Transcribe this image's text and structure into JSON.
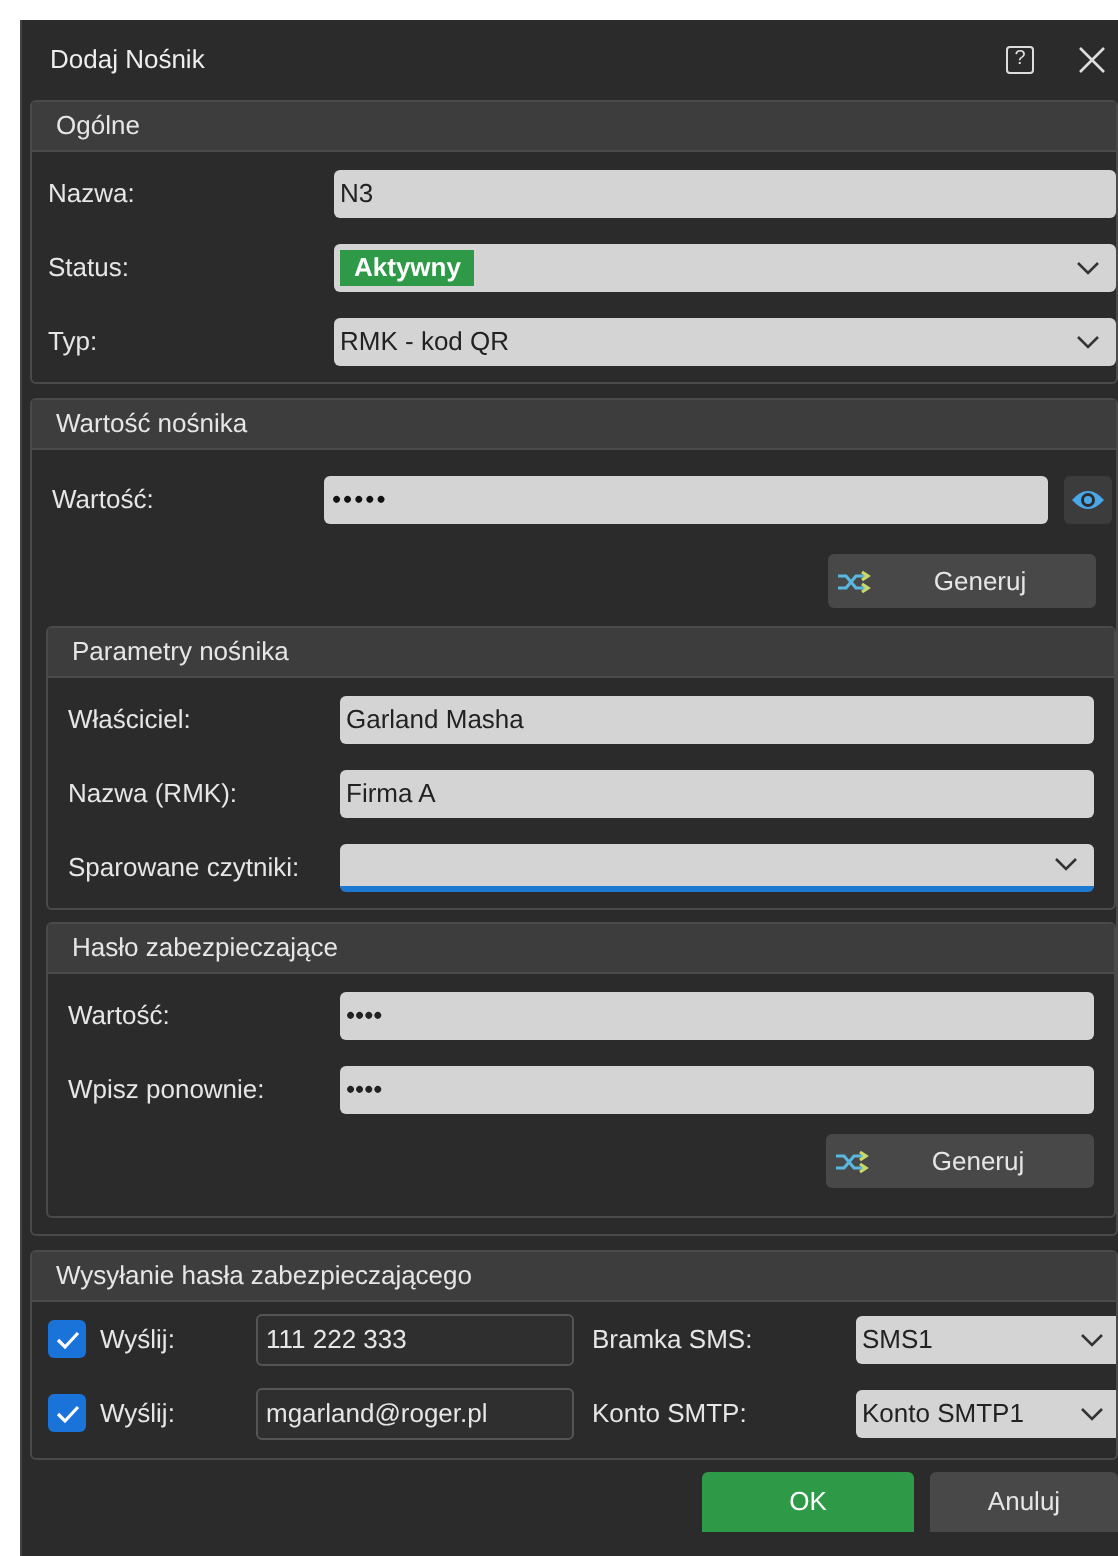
{
  "window": {
    "title": "Dodaj Nośnik",
    "help_icon_text": "?"
  },
  "general": {
    "title": "Ogólne",
    "fields": [
      {
        "kind": "text",
        "label": "Nazwa:",
        "value": "N3"
      },
      {
        "kind": "status",
        "label": "Status:",
        "value": "Aktywny",
        "color": "#2e9a48"
      },
      {
        "kind": "select",
        "label": "Typ:",
        "value": "RMK - kod QR"
      }
    ]
  },
  "carrier_value": {
    "title": "Wartość nośnika",
    "label": "Wartość:",
    "value": "•••••",
    "generate_button": "Generuj",
    "parameters": {
      "title": "Parametry nośnika",
      "fields": [
        {
          "kind": "text",
          "label": "Właściciel:",
          "value": "Garland Masha"
        },
        {
          "kind": "text",
          "label": "Nazwa (RMK):",
          "value": "Firma A"
        },
        {
          "kind": "select",
          "label": "Sparowane czytniki:",
          "focused": true
        }
      ]
    },
    "password": {
      "title": "Hasło zabezpieczające",
      "fields": [
        {
          "kind": "text",
          "label": "Wartość:",
          "value": "••••"
        },
        {
          "kind": "text",
          "label": "Wpisz ponownie:",
          "value": "••••"
        }
      ],
      "generate_button": "Generuj"
    }
  },
  "sending": {
    "title": "Wysyłanie hasła zabezpieczającego",
    "rows": [
      {
        "checked": true,
        "label": "Wyślij:",
        "value": "111 222 333",
        "gateway_label": "Bramka SMS:",
        "gateway_value": "SMS1"
      },
      {
        "checked": true,
        "label": "Wyślij:",
        "value": "mgarland@roger.pl",
        "gateway_label": "Konto SMTP:",
        "gateway_value": "Konto SMTP1"
      }
    ]
  },
  "buttons": [
    {
      "label": "OK",
      "primary": true
    },
    {
      "label": "Anuluj",
      "primary": false
    }
  ]
}
